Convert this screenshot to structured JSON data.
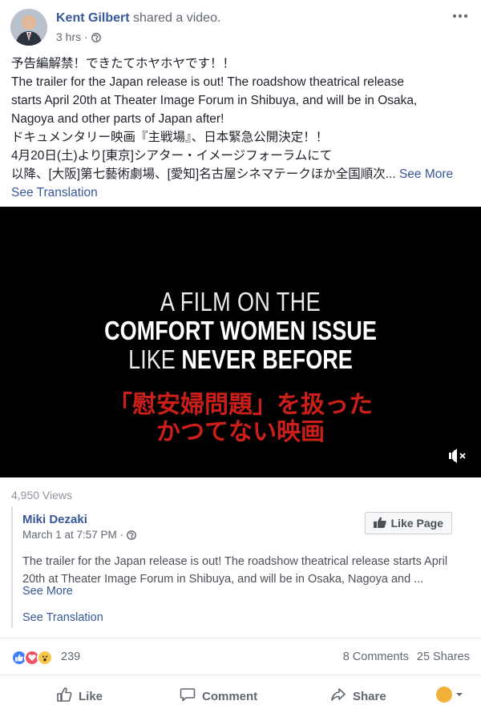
{
  "post": {
    "author": "Kent Gilbert",
    "action": "shared a video.",
    "time": "3 hrs ·",
    "text_lines": [
      "予告編解禁！できたてホヤホヤです！！",
      "The trailer for the Japan release is out! The roadshow theatrical release",
      "starts April 20th at Theater Image Forum in Shibuya, and will be in Osaka,",
      "Nagoya and other parts of Japan after!",
      "ドキュメンタリー映画『主戦場』、日本緊急公開決定！！",
      "4月20日(土)より[東京]シアター・イメージフォーラムにて",
      "以降、[大阪]第七藝術劇場、[愛知]名古屋シネマテークほか全国順次... "
    ],
    "see_more": "See More",
    "see_translation": "See Translation"
  },
  "video": {
    "line1": "A FILM ON THE",
    "line2": "COMFORT WOMEN ISSUE",
    "line3_a": "LIKE ",
    "line3_b": "NEVER BEFORE",
    "line4": "「慰安婦問題」を扱った",
    "line5": "かつてない映画",
    "views": "4,950 Views"
  },
  "shared": {
    "name": "Miki Dezaki",
    "time": "March 1 at 7:57 PM ·",
    "like_page": "Like Page",
    "text_lines": [
      "The trailer for the Japan release is out! The roadshow theatrical release starts April",
      "20th at Theater Image Forum in Shibuya, and will be in Osaka, Nagoya and ..."
    ],
    "see_more": "See More",
    "see_translation": "See Translation"
  },
  "reactions": {
    "count": "239",
    "comments": "8 Comments",
    "shares": "25 Shares",
    "colors": {
      "like": "#4080ff",
      "love": "#f25268",
      "wow": "#f7c64c"
    }
  },
  "actions": {
    "like": "Like",
    "comment": "Comment",
    "share": "Share"
  }
}
